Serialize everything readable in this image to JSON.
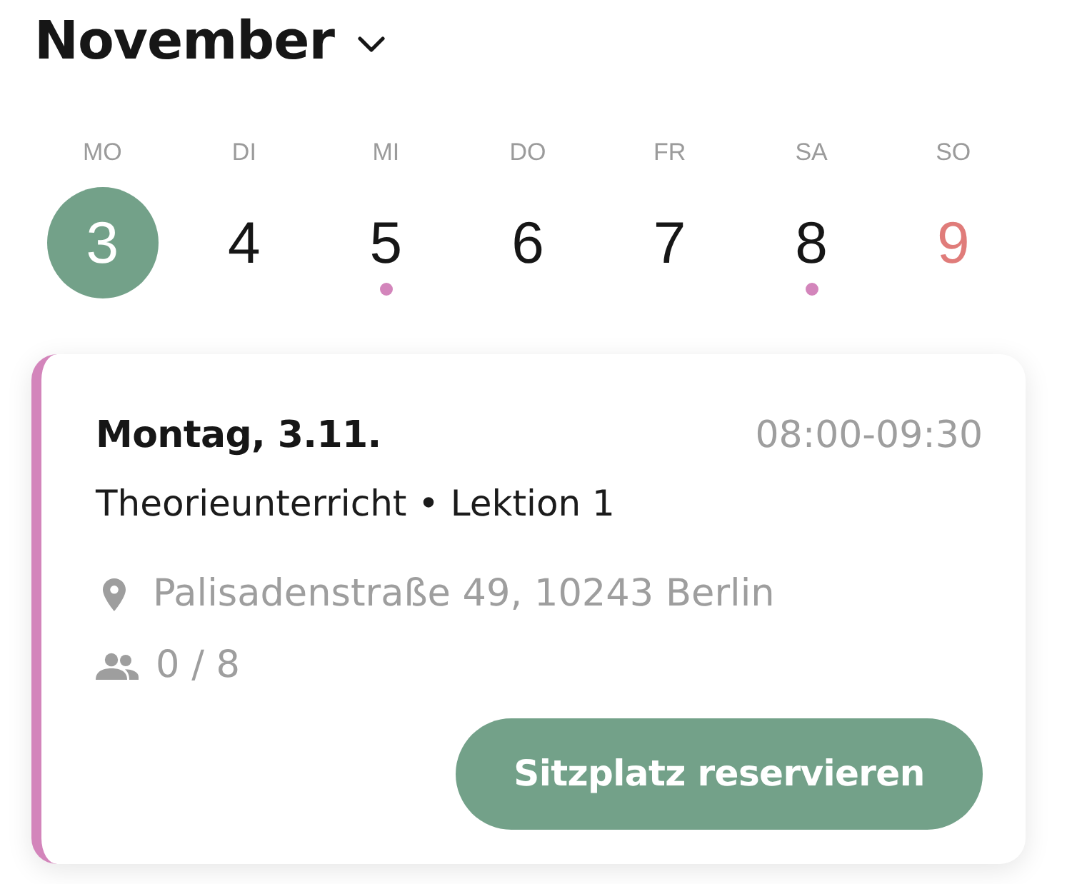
{
  "month": {
    "title": "November"
  },
  "days": [
    {
      "weekday": "MO",
      "day": "3",
      "selected": true,
      "has_event": false,
      "kind": "weekday"
    },
    {
      "weekday": "DI",
      "day": "4",
      "selected": false,
      "has_event": false,
      "kind": "weekday"
    },
    {
      "weekday": "MI",
      "day": "5",
      "selected": false,
      "has_event": true,
      "kind": "weekday"
    },
    {
      "weekday": "DO",
      "day": "6",
      "selected": false,
      "has_event": false,
      "kind": "weekday"
    },
    {
      "weekday": "FR",
      "day": "7",
      "selected": false,
      "has_event": false,
      "kind": "weekday"
    },
    {
      "weekday": "SA",
      "day": "8",
      "selected": false,
      "has_event": true,
      "kind": "weekday"
    },
    {
      "weekday": "SO",
      "day": "9",
      "selected": false,
      "has_event": false,
      "kind": "sunday"
    }
  ],
  "event": {
    "color": "#d385bb",
    "date": "Montag, 3.11.",
    "time": "08:00-09:30",
    "subtitle": "Theorieunterricht • Lektion 1",
    "address": "Palisadenstraße 49, 10243 Berlin",
    "seats": "0 / 8",
    "button": "Sitzplatz reservieren"
  }
}
